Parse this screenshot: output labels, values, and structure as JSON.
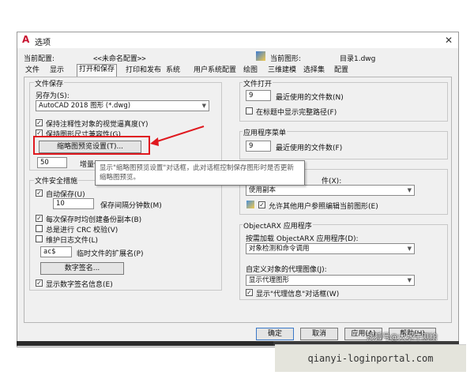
{
  "window": {
    "title": "选项",
    "app_logo": "A",
    "close_glyph": "✕"
  },
  "profile": {
    "current_config_label": "当前配置:",
    "current_config_value": "<<未命名配置>>",
    "current_drawing_label": "当前图形:",
    "current_drawing_value": "目录1.dwg"
  },
  "tabs": [
    "文件",
    "显示",
    "打开和保存",
    "打印和发布",
    "系统",
    "用户系统配置",
    "绘图",
    "三维建模",
    "选择集",
    "配置"
  ],
  "file_save": {
    "group_title": "文件保存",
    "save_as_label": "另存为(S):",
    "save_as_value": "AutoCAD 2018 图形 (*.dwg)",
    "keep_annotative": "保持注释性对象的视觉逼真度(Y)",
    "keep_drawing_size": "保持图形尺寸兼容性(G)",
    "thumbnail_button": "缩略图预览设置(T)...",
    "incremental_value": "50",
    "incremental_label": "增量保存百分比(I)"
  },
  "tooltip": "显示\"缩略图预览设置\"对话框，此对话框控制保存图形时是否更新缩略图预览。",
  "file_safety": {
    "group_title": "文件安全措施",
    "autosave_label": "自动保存(U)",
    "autosave_minutes": "10",
    "autosave_minutes_label": "保存间隔分钟数(M)",
    "backup_copy": "每次保存时均创建备份副本(B)",
    "crc_check": "总是进行 CRC 校验(V)",
    "log_file": "维护日志文件(L)",
    "temp_ext_value": "ac$",
    "temp_ext_label": "临时文件的扩展名(P)",
    "digital_sig_button": "数字签名...",
    "show_sig_info": "显示数字签名信息(E)"
  },
  "file_open": {
    "group_title": "文件打开",
    "recent_count": "9",
    "recent_label": "最近使用的文件数(N)",
    "full_path_label": "在标题中显示完整路径(F)"
  },
  "app_menu": {
    "group_title": "应用程序菜单",
    "recent_count": "9",
    "recent_label": "最近使用的文件数(F)"
  },
  "xref": {
    "label_tail": "件(X):",
    "combo_value": "使用副本",
    "allow_edit": "允许其他用户参照编辑当前图形(E)"
  },
  "objectarx": {
    "group_title": "ObjectARX 应用程序",
    "load_label": "按需加载 ObjectARX 应用程序(D):",
    "load_value": "对象检测和命令调用",
    "proxy_label": "自定义对象的代理图像(J):",
    "proxy_value": "显示代理图形",
    "proxy_dialog": "显示\"代理信息\"对话框(W)"
  },
  "footer": {
    "ok": "确定",
    "cancel": "取消",
    "apply": "应用(A)",
    "help": "帮助(H)"
  },
  "watermark": "搜狐号@大水牛测绘",
  "banner": "qianyi-loginportal.com"
}
